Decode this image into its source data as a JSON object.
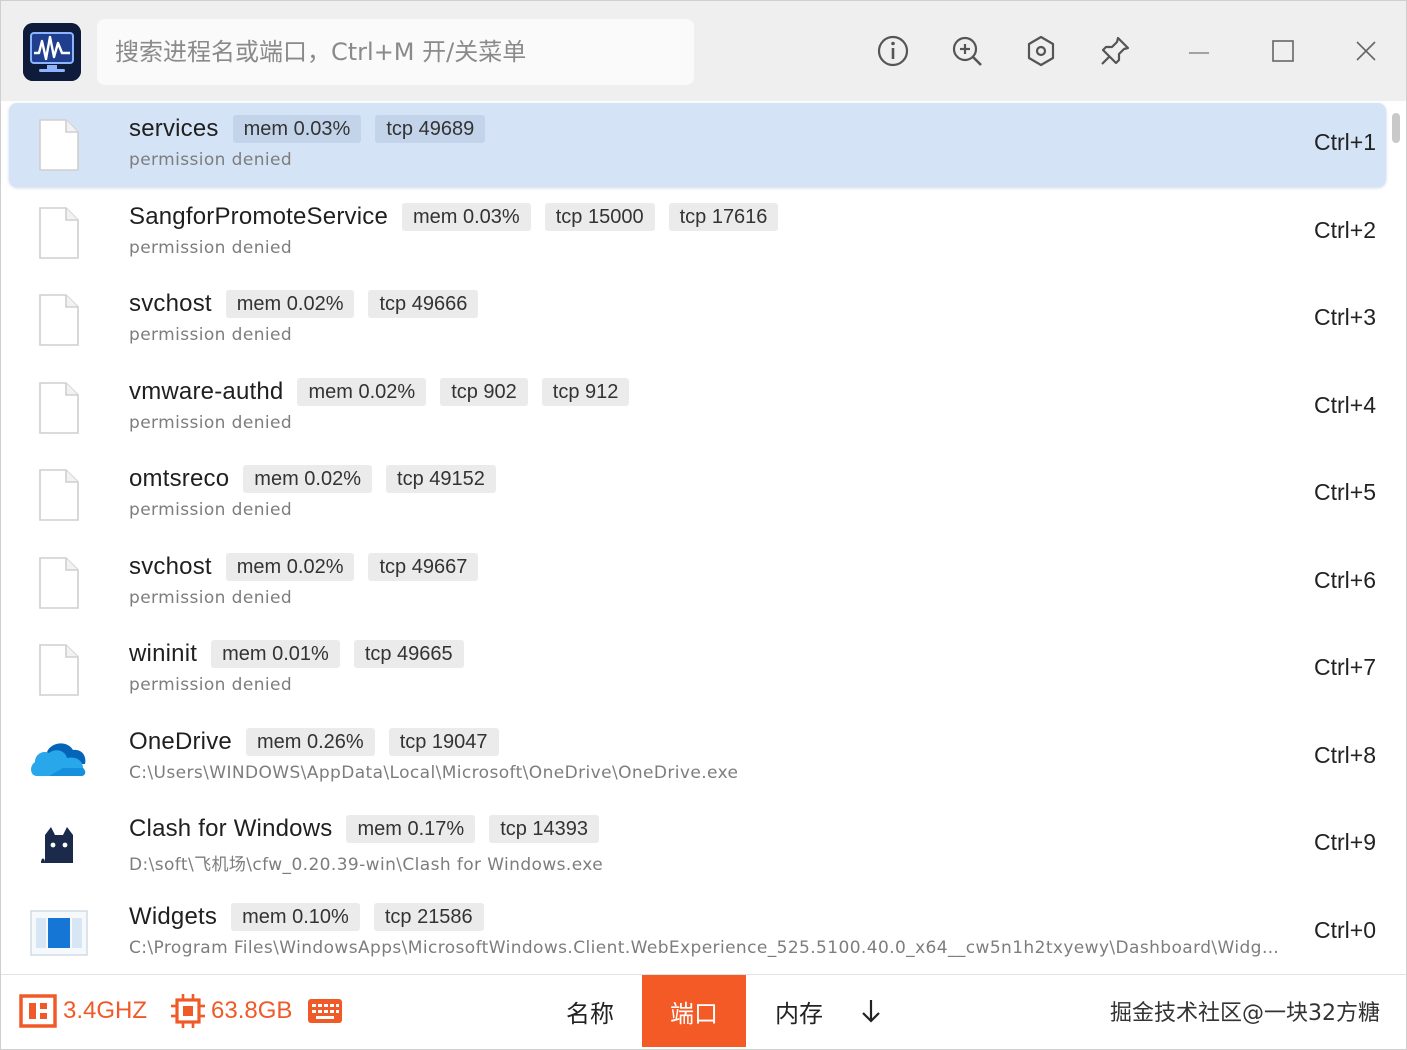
{
  "header": {
    "search_placeholder": "搜索进程名或端口，Ctrl+M 开/关菜单",
    "icons": [
      "info-icon",
      "zoom-in-icon",
      "settings-icon",
      "pin-icon",
      "minimize-icon",
      "maximize-icon",
      "close-icon"
    ]
  },
  "processes": [
    {
      "name": "services",
      "tags": [
        "mem 0.03%",
        "tcp 49689"
      ],
      "path": "permission denied",
      "shortcut": "Ctrl+1",
      "icon": "file-icon",
      "selected": true
    },
    {
      "name": "SangforPromoteService",
      "tags": [
        "mem 0.03%",
        "tcp 15000",
        "tcp 17616"
      ],
      "path": "permission denied",
      "shortcut": "Ctrl+2",
      "icon": "file-icon"
    },
    {
      "name": "svchost",
      "tags": [
        "mem 0.02%",
        "tcp 49666"
      ],
      "path": "permission denied",
      "shortcut": "Ctrl+3",
      "icon": "file-icon"
    },
    {
      "name": "vmware-authd",
      "tags": [
        "mem 0.02%",
        "tcp 902",
        "tcp 912"
      ],
      "path": "permission denied",
      "shortcut": "Ctrl+4",
      "icon": "file-icon"
    },
    {
      "name": "omtsreco",
      "tags": [
        "mem 0.02%",
        "tcp 49152"
      ],
      "path": "permission denied",
      "shortcut": "Ctrl+5",
      "icon": "file-icon"
    },
    {
      "name": "svchost",
      "tags": [
        "mem 0.02%",
        "tcp 49667"
      ],
      "path": "permission denied",
      "shortcut": "Ctrl+6",
      "icon": "file-icon"
    },
    {
      "name": "wininit",
      "tags": [
        "mem 0.01%",
        "tcp 49665"
      ],
      "path": "permission denied",
      "shortcut": "Ctrl+7",
      "icon": "file-icon"
    },
    {
      "name": "OneDrive",
      "tags": [
        "mem 0.26%",
        "tcp 19047"
      ],
      "path": "C:\\Users\\WINDOWS\\AppData\\Local\\Microsoft\\OneDrive\\OneDrive.exe",
      "shortcut": "Ctrl+8",
      "icon": "onedrive-cloud-icon"
    },
    {
      "name": "Clash for Windows",
      "tags": [
        "mem 0.17%",
        "tcp 14393"
      ],
      "path": "D:\\soft\\飞机场\\cfw_0.20.39-win\\Clash for Windows.exe",
      "shortcut": "Ctrl+9",
      "icon": "clash-cat-icon"
    },
    {
      "name": "Widgets",
      "tags": [
        "mem 0.10%",
        "tcp 21586"
      ],
      "path": "C:\\Program Files\\WindowsApps\\MicrosoftWindows.Client.WebExperience_525.5100.40.0_x64__cw5n1h2txyewy\\Dashboard\\Widge…",
      "shortcut": "Ctrl+0",
      "icon": "widgets-icon"
    }
  ],
  "footer": {
    "cpu": "3.4GHZ",
    "memory": "63.8GB",
    "sort_name": "名称",
    "sort_port": "端口",
    "sort_mem": "内存",
    "active_sort": "端口",
    "watermark": "掘金技术社区@一块32方糖",
    "accent_color": "#f35a26",
    "selected_row_color": "#d4e3f6"
  }
}
